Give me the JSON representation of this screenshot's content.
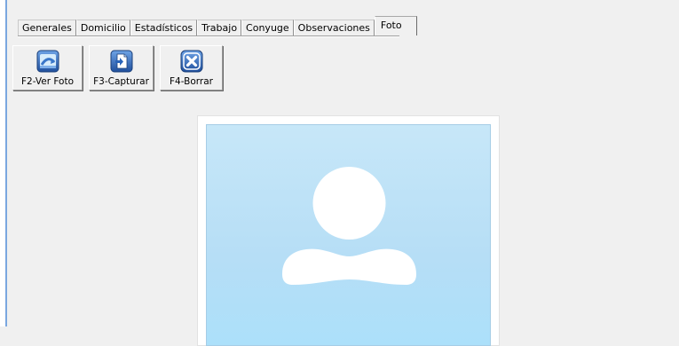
{
  "tabs": [
    "Generales",
    "Domicilio",
    "Estadísticos",
    "Trabajo",
    "Conyuge",
    "Observaciones",
    "Foto"
  ],
  "active_tab": "Foto",
  "toolbar": {
    "view_label": "F2-Ver Foto",
    "capture_label": "F3-Capturar",
    "delete_label": "F4-Borrar"
  },
  "icons": {
    "view": "refresh-photo-icon",
    "capture": "document-capture-icon",
    "delete": "delete-x-icon"
  },
  "colors": {
    "window_bg": "#f0f0f0",
    "photo_bg": "#c2e5f7",
    "avatar": "#ffffff",
    "icon_blue": "#2a64b8"
  }
}
